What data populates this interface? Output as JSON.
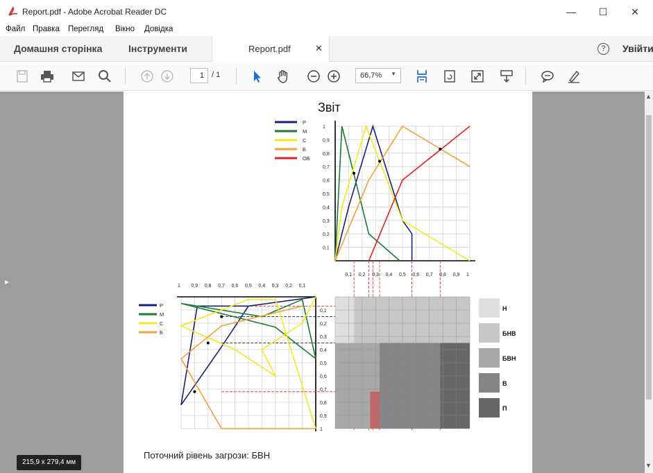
{
  "window": {
    "title": "Report.pdf - Adobe Acrobat Reader DC"
  },
  "menu": [
    "Файл",
    "Правка",
    "Перегляд",
    "Вікно",
    "Довідка"
  ],
  "tabs": {
    "home": "Домашня сторінка",
    "tools": "Інструменти",
    "document": "Report.pdf",
    "signin": "Увійти"
  },
  "toolbar": {
    "page_current": "1",
    "page_total": "/ 1",
    "zoom": "66,7%"
  },
  "status": {
    "page_size": "215,9 x 279,4 мм"
  },
  "report": {
    "title": "Звіт",
    "threat_level_text": "Поточний рівень загрози: БВН"
  },
  "colors": {
    "P": "#1a1f7a",
    "M": "#1a7a35",
    "C": "#f2ea1c",
    "B": "#f4a032",
    "OB": "#e02020"
  },
  "chart_data": [
    {
      "type": "line",
      "title": "",
      "legend": [
        "Р",
        "М",
        "С",
        "Б",
        "ОБ"
      ],
      "legend_position": "top-left",
      "x_ticks": [
        "0,1",
        "0,2",
        "0,3",
        "0,4",
        "0,5",
        "0,6",
        "0,7",
        "0,8",
        "0,9",
        "1"
      ],
      "y_ticks": [
        "0,1",
        "0,2",
        "0,3",
        "0,4",
        "0,5",
        "0,6",
        "0,7",
        "0,8",
        "0,9",
        "1"
      ],
      "xlim": [
        0,
        1
      ],
      "ylim": [
        0,
        1
      ],
      "grid": true,
      "series": [
        {
          "name": "Р",
          "x": [
            0,
            0.1,
            0.28,
            0.5,
            0.57,
            0.57
          ],
          "y": [
            0,
            0.4,
            1,
            0.3,
            0.2,
            0
          ]
        },
        {
          "name": "М",
          "x": [
            0,
            0.05,
            0.25,
            0.48
          ],
          "y": [
            0,
            1,
            0.2,
            0
          ]
        },
        {
          "name": "С",
          "x": [
            0,
            0.05,
            0.23,
            0.5,
            1
          ],
          "y": [
            0,
            0.4,
            1,
            0.3,
            0
          ]
        },
        {
          "name": "Б",
          "x": [
            0,
            0.25,
            0.5,
            1
          ],
          "y": [
            0,
            0.6,
            1,
            0.7
          ]
        },
        {
          "name": "ОБ",
          "x": [
            0.25,
            0.5,
            1
          ],
          "y": [
            0,
            0.6,
            1
          ]
        }
      ],
      "marked_points": [
        [
          0.14,
          0.65
        ],
        [
          0.33,
          0.74
        ],
        [
          0.78,
          0.83
        ]
      ]
    },
    {
      "type": "line",
      "title": "",
      "legend": [
        "Р",
        "М",
        "С",
        "Б"
      ],
      "legend_position": "top-left",
      "x_ticks": [
        "1",
        "0,9",
        "0,8",
        "0,7",
        "0,6",
        "0,5",
        "0,4",
        "0,3",
        "0,2",
        "0,1"
      ],
      "y_ticks": [
        "0,1",
        "0,2",
        "0,3",
        "0,4",
        "0,5",
        "0,6",
        "0,7",
        "0,8",
        "0,9",
        "1"
      ],
      "xlim": [
        1,
        0
      ],
      "ylim": [
        0,
        1
      ],
      "grid": true,
      "series": [
        {
          "name": "Р",
          "x": [
            0,
            0.5,
            0.88,
            1,
            0.7,
            0.5,
            0.5
          ],
          "y": [
            0,
            0.07,
            0.07,
            0.82,
            0.38,
            0.07,
            0.07
          ]
        },
        {
          "name": "М",
          "x": [
            0,
            0.3,
            1,
            0.4,
            0.1,
            0
          ],
          "y": [
            0.47,
            0.23,
            0.05,
            0.15,
            0.02,
            0.47
          ]
        },
        {
          "name": "С",
          "x": [
            0,
            0.1,
            0.4,
            0.3,
            0.6,
            1,
            0.5,
            0.3,
            0
          ],
          "y": [
            0,
            0.2,
            0.4,
            0.6,
            0.4,
            0.22,
            0.02,
            0.02,
            1
          ]
        },
        {
          "name": "Б",
          "x": [
            0,
            0.7,
            1,
            0.7,
            0.1
          ],
          "y": [
            1,
            1,
            0.47,
            0.22,
            0.07
          ]
        }
      ],
      "marked_points": [
        [
          0.7,
          0.15
        ],
        [
          0.8,
          0.35
        ],
        [
          0.9,
          0.72
        ]
      ]
    }
  ],
  "zones": [
    {
      "label": "Н",
      "color": "#dedede"
    },
    {
      "label": "БНВ",
      "color": "#c6c6c6"
    },
    {
      "label": "БВН",
      "color": "#a8a8a8"
    },
    {
      "label": "В",
      "color": "#858585"
    },
    {
      "label": "П",
      "color": "#676767"
    }
  ]
}
